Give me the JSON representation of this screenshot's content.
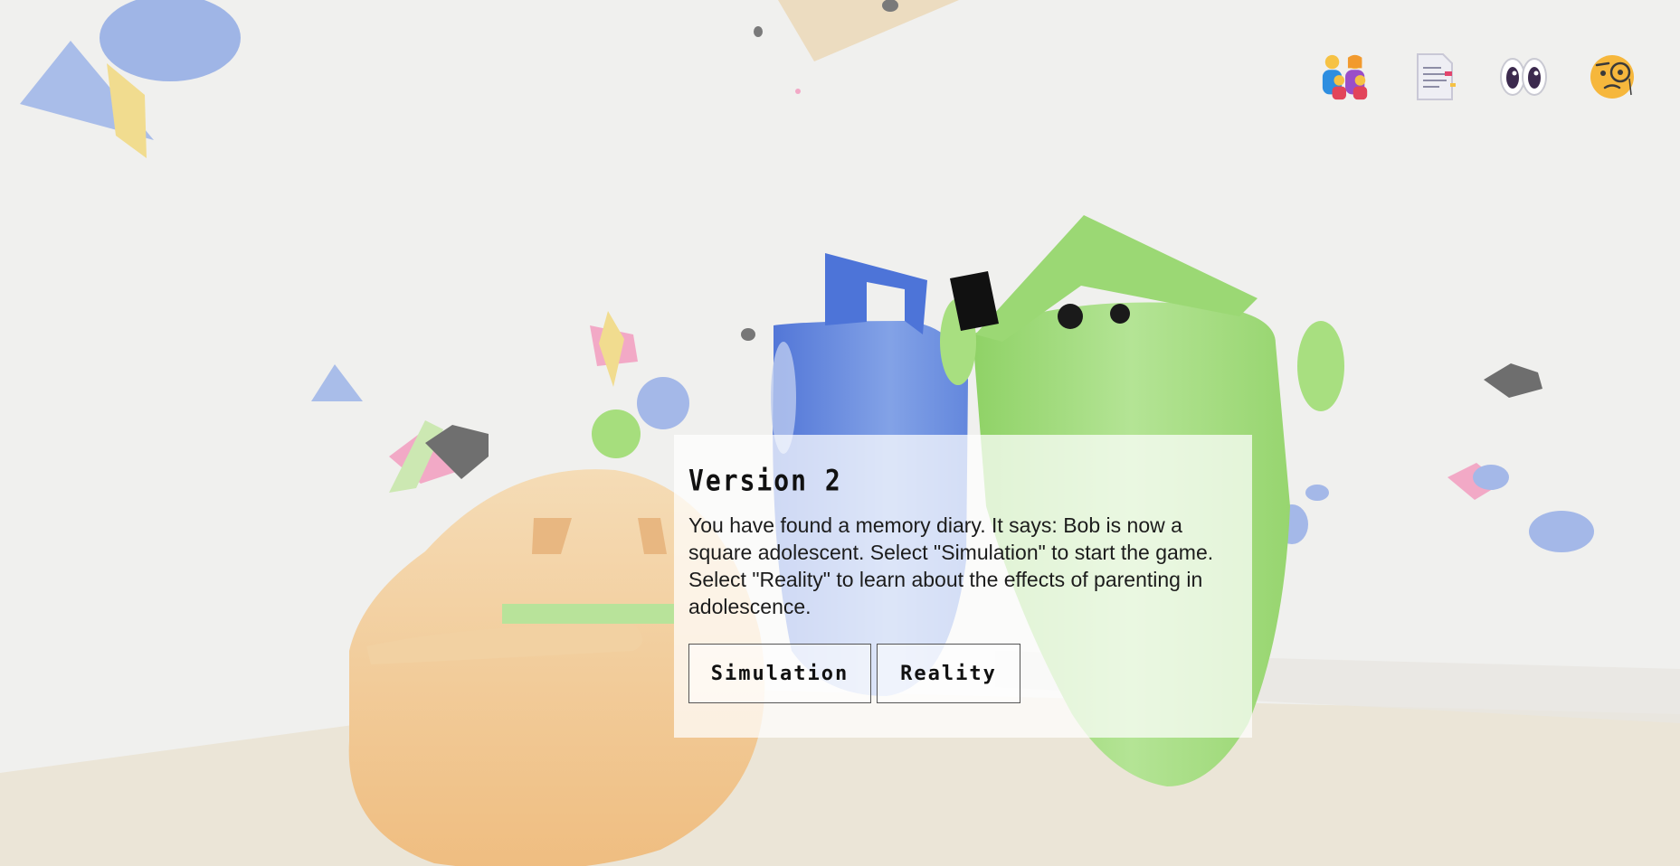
{
  "toolbar": {
    "icons": [
      {
        "name": "family-icon",
        "label": "Family"
      },
      {
        "name": "diary-page-icon",
        "label": "Diary"
      },
      {
        "name": "eyes-icon",
        "label": "Look"
      },
      {
        "name": "monocle-face-icon",
        "label": "Inspect"
      }
    ]
  },
  "dialog": {
    "title": "Version 2",
    "text": "You have found a memory diary. It says: Bob is now a square adolescent. Select \"Simulation\" to start the game. Select \"Reality\" to learn about the effects of parenting in adolescence.",
    "buttons": {
      "simulation": "Simulation",
      "reality": "Reality"
    }
  },
  "colors": {
    "background": "#f0f0ee",
    "floor": "#ece4d4",
    "blue_character": "#5a82de",
    "green_character": "#a3dc7a",
    "orange_character": "#f3cf9e",
    "pink_shape": "#f2a9c6",
    "yellow_shape": "#f1dc8f",
    "gray_rock": "#6f6f6f"
  }
}
